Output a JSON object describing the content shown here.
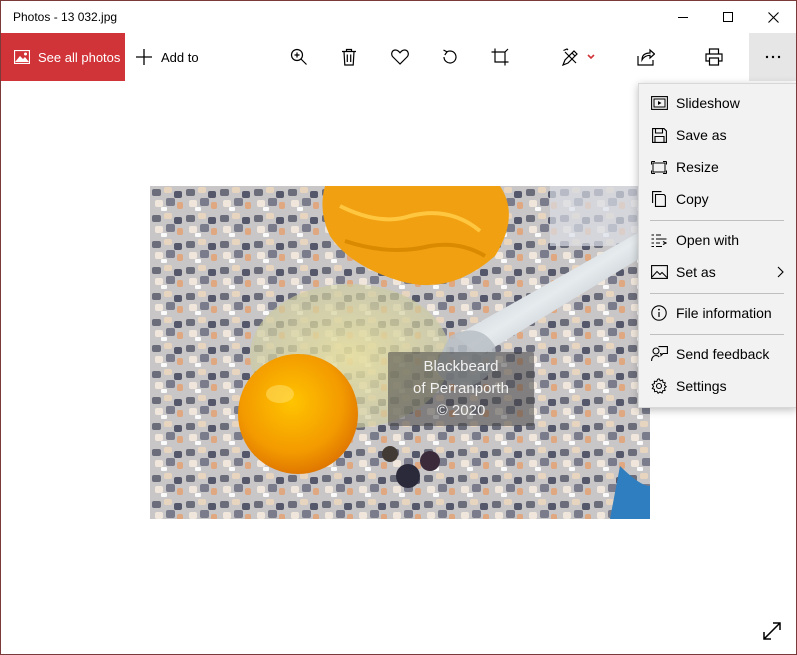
{
  "window": {
    "title": "Photos - 13 032.jpg"
  },
  "title_controls": {
    "minimize": "minimize-icon",
    "maximize": "maximize-icon",
    "close": "close-icon"
  },
  "toolbar": {
    "see_all_label": "See all photos",
    "add_to_label": "Add to",
    "accent_color": "#d13438",
    "icons": [
      "zoom-in-icon",
      "delete-icon",
      "heart-icon",
      "rotate-icon",
      "crop-icon",
      "edit-draw-icon",
      "share-icon",
      "print-icon",
      "more-icon"
    ]
  },
  "photo": {
    "watermark_lines": [
      "Blackbeard",
      "of Perranporth",
      "© 2020"
    ]
  },
  "context_menu": {
    "items": [
      {
        "label": "Slideshow",
        "icon": "slideshow-icon"
      },
      {
        "label": "Save as",
        "icon": "save-icon"
      },
      {
        "label": "Resize",
        "icon": "resize-icon"
      },
      {
        "label": "Copy",
        "icon": "copy-icon"
      },
      {
        "label": "Open with",
        "icon": "open-with-icon"
      },
      {
        "label": "Set as",
        "icon": "set-as-icon",
        "has_submenu": true
      },
      {
        "label": "File information",
        "icon": "info-icon"
      },
      {
        "label": "Send feedback",
        "icon": "feedback-icon"
      },
      {
        "label": "Settings",
        "icon": "gear-icon"
      }
    ]
  }
}
